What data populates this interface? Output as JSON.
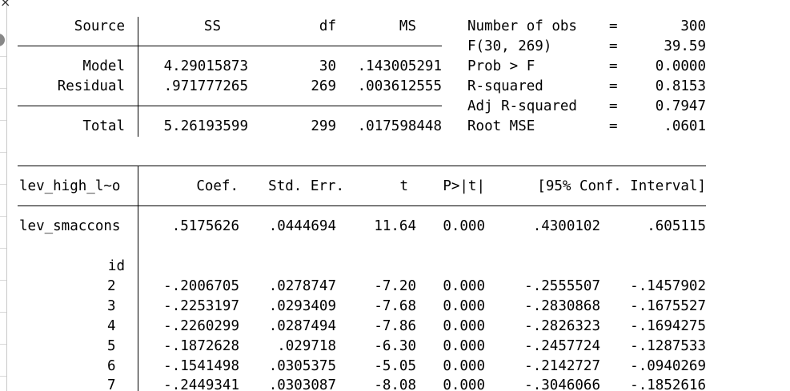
{
  "anova": {
    "headers": [
      "Source",
      "SS",
      "df",
      "MS"
    ],
    "rows": [
      {
        "source": "Model",
        "ss": "4.29015873",
        "df": "30",
        "ms": ".143005291"
      },
      {
        "source": "Residual",
        "ss": ".971777265",
        "df": "269",
        "ms": ".003612555"
      },
      {
        "source": "Total",
        "ss": "5.26193599",
        "df": "299",
        "ms": ".017598448"
      }
    ]
  },
  "stats": [
    {
      "label": "Number of obs",
      "eq": "=",
      "value": "300"
    },
    {
      "label": "F(30, 269)",
      "eq": "=",
      "value": "39.59"
    },
    {
      "label": "Prob > F",
      "eq": "=",
      "value": "0.0000"
    },
    {
      "label": "R-squared",
      "eq": "=",
      "value": "0.8153"
    },
    {
      "label": "Adj R-squared",
      "eq": "=",
      "value": "0.7947"
    },
    {
      "label": "Root MSE",
      "eq": "=",
      "value": ".0601"
    }
  ],
  "coef": {
    "depvar": "lev_high_l~o",
    "headers": [
      "Coef.",
      "Std. Err.",
      "t",
      "P>|t|",
      "[95% Conf. Interval]"
    ],
    "main": {
      "name": "lev_smaccons",
      "coef": ".5175626",
      "se": ".0444694",
      "t": "11.64",
      "p": "0.000",
      "lo": ".4300102",
      "hi": ".605115"
    },
    "group_label": "id",
    "rows": [
      {
        "name": "2",
        "coef": "-.2006705",
        "se": ".0278747",
        "t": "-7.20",
        "p": "0.000",
        "lo": "-.2555507",
        "hi": "-.1457902"
      },
      {
        "name": "3",
        "coef": "-.2253197",
        "se": ".0293409",
        "t": "-7.68",
        "p": "0.000",
        "lo": "-.2830868",
        "hi": "-.1675527"
      },
      {
        "name": "4",
        "coef": "-.2260299",
        "se": ".0287494",
        "t": "-7.86",
        "p": "0.000",
        "lo": "-.2826323",
        "hi": "-.1694275"
      },
      {
        "name": "5",
        "coef": "-.1872628",
        "se": ".029718",
        "t": "-6.30",
        "p": "0.000",
        "lo": "-.2457724",
        "hi": "-.1287533"
      },
      {
        "name": "6",
        "coef": "-.1541498",
        "se": ".0305375",
        "t": "-5.05",
        "p": "0.000",
        "lo": "-.2142727",
        "hi": "-.0940269"
      },
      {
        "name": "7",
        "coef": "-.2449341",
        "se": ".0303087",
        "t": "-8.08",
        "p": "0.000",
        "lo": "-.3046066",
        "hi": "-.1852616"
      }
    ]
  }
}
